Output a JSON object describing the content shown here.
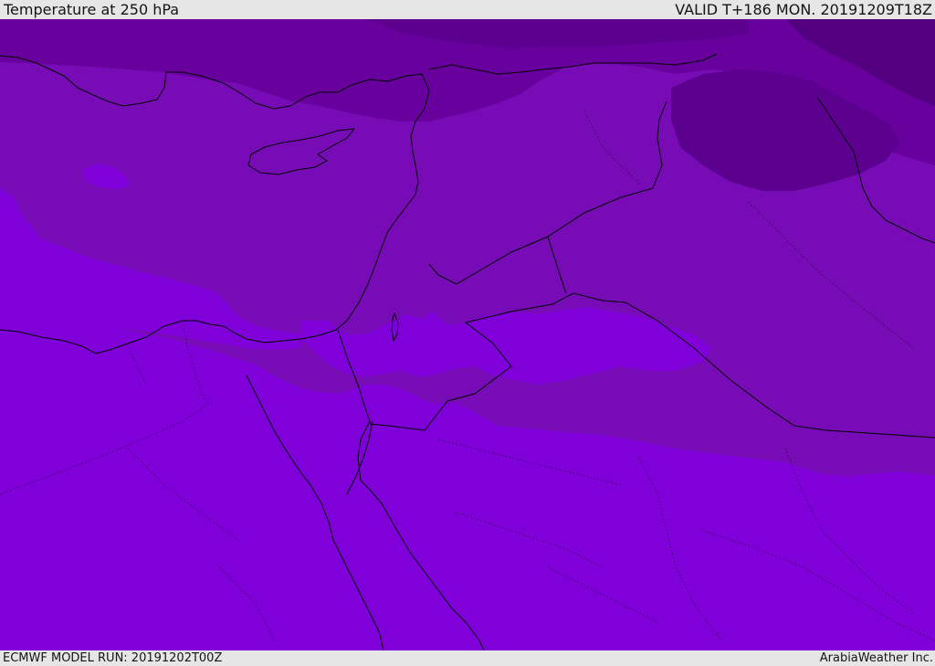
{
  "header": {
    "title": "Temperature at 250 hPa",
    "valid_time": "VALID T+186 MON. 20191209T18Z"
  },
  "footer": {
    "model_run": "ECMWF MODEL RUN: 20191202T00Z",
    "credit": "ArabiaWeather Inc."
  },
  "map": {
    "colors": {
      "band_warmest": "#7f00d9",
      "band_mid": "#770cb6",
      "band_cold": "#68009e",
      "band_colder": "#5c0090",
      "band_coldest": "#52007f",
      "outline": "#000000"
    }
  }
}
